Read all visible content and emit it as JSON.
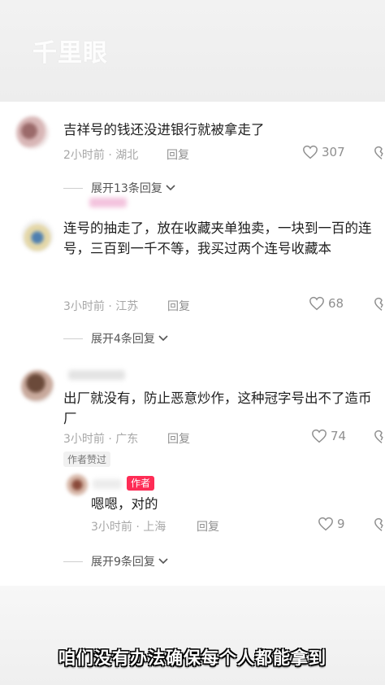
{
  "watermark": "千里眼",
  "comments": [
    {
      "text": "吉祥号的钱还没进银行就被拿走了",
      "time_location": "2小时前 · 湖北",
      "reply_label": "回复",
      "likes": "307",
      "expand_label": "展开13条回复"
    },
    {
      "text": "连号的抽走了，放在收藏夹单独卖，一块到一百的连号，三百到一千不等，我买过两个连号收藏本",
      "time_location": "3小时前 · 江苏",
      "reply_label": "回复",
      "likes": "68",
      "expand_label": "展开4条回复"
    },
    {
      "text": "出厂就没有，防止恶意炒作，这种冠字号出不了造币厂",
      "time_location": "3小时前 · 广东",
      "reply_label": "回复",
      "likes": "74",
      "author_liked_tag": "作者赞过",
      "reply": {
        "author_badge": "作者",
        "text": "嗯嗯，对的",
        "time_location": "3小时前 · 上海",
        "reply_label": "回复",
        "likes": "9"
      },
      "expand_label": "展开9条回复"
    }
  ],
  "subtitle": "咱们没有办法确保每个人都能拿到",
  "icons": {
    "like": "heart-outline-icon",
    "dislike": "broken-heart-icon",
    "expand": "chevron-down-icon"
  },
  "colors": {
    "author_badge": "#fe2c55",
    "meta_text": "#a7a7a7"
  }
}
